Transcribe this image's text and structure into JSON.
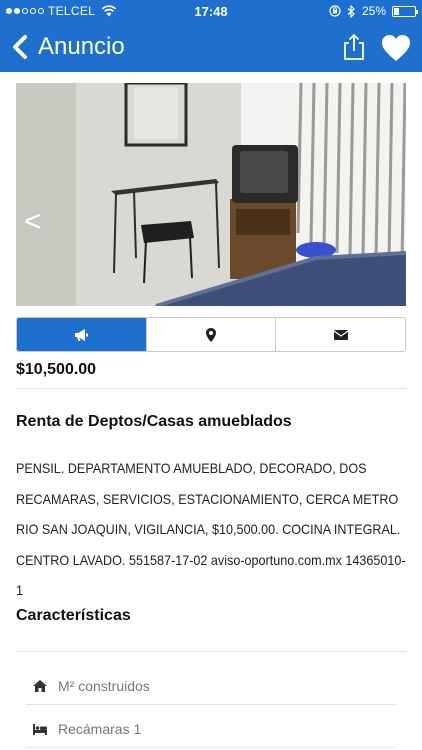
{
  "status_bar": {
    "carrier": "TELCEL",
    "time": "17:48",
    "battery": "25%",
    "battery_level": 0.25,
    "signal_bars": 2
  },
  "navbar": {
    "title": "Anuncio",
    "back_icon": "chevron-left-icon",
    "share_icon": "share-icon",
    "favorite_icon": "heart-icon"
  },
  "gallery": {
    "prev_label": "<"
  },
  "action_tabs": [
    {
      "icon": "megaphone-icon"
    },
    {
      "icon": "map-marker-icon"
    },
    {
      "icon": "envelope-icon"
    }
  ],
  "listing": {
    "price": "$10,500.00",
    "category": "Renta de Deptos/Casas amueblados",
    "description": "PENSIL. DEPARTAMENTO AMUEBLADO, DECORADO, DOS RECAMARAS, SERVICIOS, ESTACIONAMIENTO, CERCA METRO RIO SAN JOAQUIN, VIGILANCIA, $10,500.00. COCINA INTEGRAL. CENTRO LAVADO. 551587-17-02 aviso-oportuno.com.mx 14365010-1"
  },
  "features": {
    "title": "Características",
    "items": [
      {
        "icon": "home-icon",
        "label": "M² construidos"
      },
      {
        "icon": "bed-icon",
        "label": "Recámaras 1"
      }
    ]
  },
  "colors": {
    "brand": "#1f6fcf",
    "divider": "#e3e3e3"
  }
}
